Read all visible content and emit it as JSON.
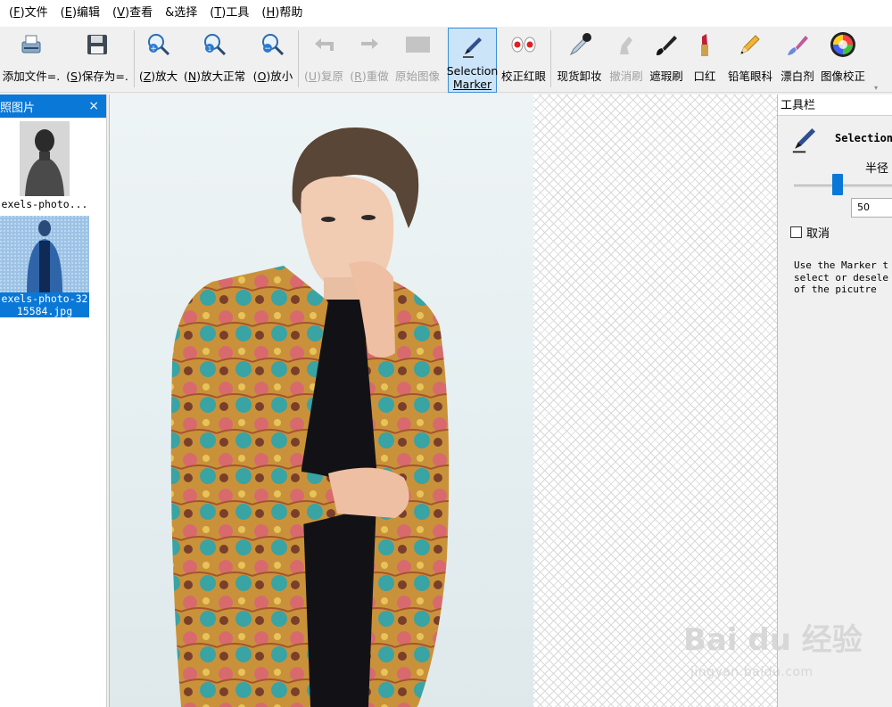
{
  "menu": [
    {
      "key": "F",
      "label": "文件"
    },
    {
      "key": "E",
      "label": "编辑"
    },
    {
      "key": "V",
      "label": "查看"
    },
    {
      "key": "",
      "label": "&选择"
    },
    {
      "key": "T",
      "label": "工具"
    },
    {
      "key": "H",
      "label": "帮助"
    }
  ],
  "toolbar": {
    "add_file": "添加文件=.",
    "save_as_key": "S",
    "save_as": "保存为=.",
    "zoom_in_key": "Z",
    "zoom_in": "放大",
    "zoom_normal_key": "N",
    "zoom_normal": "放大正常",
    "zoom_out_key": "O",
    "zoom_out": "放小",
    "undo_key": "U",
    "undo": "复原",
    "redo_key": "R",
    "redo": "重做",
    "original": "原始图像",
    "selection_marker_line1": "Selection",
    "selection_marker_line2": "Marker",
    "red_eye": "校正红眼",
    "remove_makeup": "现货卸妆",
    "undo_brush": "撤消刷",
    "blemish": "遮瑕刷",
    "lipstick": "口红",
    "eyeliner": "铅笔眼科",
    "whitener": "漂白剂",
    "color_correct": "图像校正"
  },
  "left_panel": {
    "title": "照图片",
    "close": "×",
    "thumbnails": [
      {
        "caption": "exels-photo..."
      },
      {
        "caption_line1": "exels-photo-32",
        "caption_line2": "15584.jpg"
      }
    ]
  },
  "right_panel": {
    "title": "工具栏",
    "tool_title": "Selection",
    "radius_label": "半径",
    "radius_value": "50",
    "slider_value": 50,
    "cancel_label": "取消",
    "cancel_checked": false,
    "description": "Use the Marker t\nselect or desele\nof the picutre"
  },
  "watermark": {
    "logo": "Bai du 经验",
    "sub": "jingyan.baidu.com"
  },
  "colors": {
    "accent": "#0a78d7",
    "active_tool_bg": "#cce4f7"
  }
}
